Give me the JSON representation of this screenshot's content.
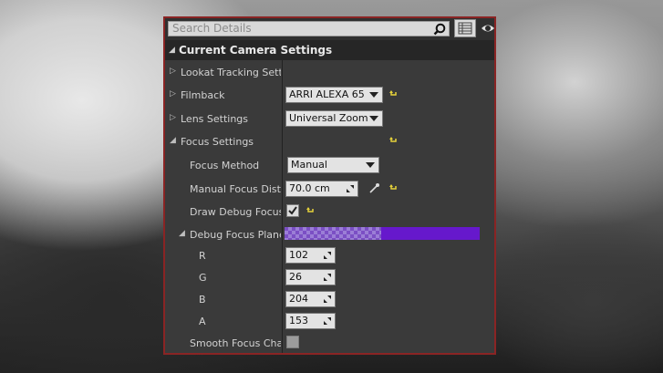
{
  "search": {
    "placeholder": "Search Details"
  },
  "section": {
    "title": "Current Camera Settings"
  },
  "rows": {
    "lookat": {
      "label": "Lookat Tracking Settings"
    },
    "filmback": {
      "label": "Filmback",
      "value": "ARRI ALEXA 65"
    },
    "lens": {
      "label": "Lens Settings",
      "value": "Universal Zoom"
    },
    "focus": {
      "label": "Focus Settings"
    },
    "method": {
      "label": "Focus Method",
      "value": "Manual"
    },
    "distance": {
      "label": "Manual Focus Distance",
      "value": "70.0 cm"
    },
    "drawDebug": {
      "label": "Draw Debug Focus Plane",
      "checked": true
    },
    "debugColor": {
      "label": "Debug Focus Plane Color",
      "color": "#6618cc"
    },
    "r": {
      "label": "R",
      "value": "102"
    },
    "g": {
      "label": "G",
      "value": "26"
    },
    "b": {
      "label": "B",
      "value": "204"
    },
    "a": {
      "label": "A",
      "value": "153"
    },
    "smooth": {
      "label": "Smooth Focus Changes",
      "checked": false
    }
  },
  "colors": {
    "accent_border": "#8a2424",
    "reset_arrow": "#e6d23a"
  }
}
